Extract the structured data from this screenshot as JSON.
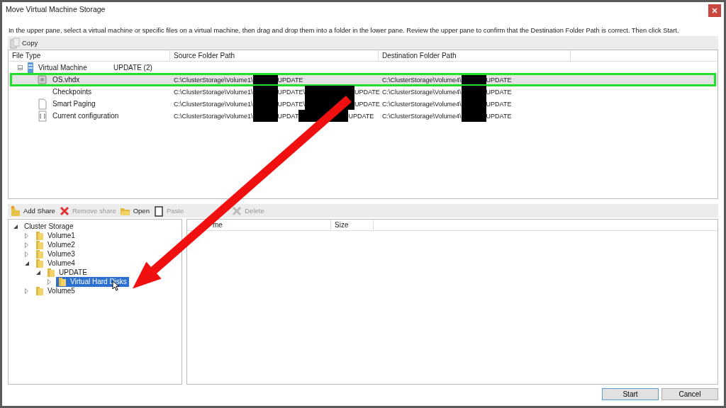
{
  "window": {
    "title": "Move Virtual Machine Storage"
  },
  "instructions": "In the upper pane, select a virtual machine or specific files on a virtual machine, then drag and drop them into a folder in the lower pane.  Review the upper pane to confirm that the Destination Folder Path is correct. Then click Start.",
  "upper_toolbar": [
    {
      "label": "Copy"
    }
  ],
  "upper_table": {
    "columns": [
      "File Type",
      "Source Folder Path",
      "Destination Folder Path"
    ],
    "group": {
      "label": "Virtual Machine",
      "name": "UPDATE (2)",
      "expanded": true
    },
    "rows": [
      {
        "kind": "disk",
        "name": "OS.vhdx",
        "selected": true,
        "source": [
          "C:\\ClusterStorage\\Volume1\\",
          "UPDATE"
        ],
        "destination": [
          "C:\\ClusterStorage\\Volume4\\",
          "UPDATE"
        ]
      },
      {
        "kind": "none",
        "name": "Checkpoints",
        "selected": false,
        "source": [
          "C:\\ClusterStorage\\Volume1\\",
          "UPDATE\\",
          "UPDATE"
        ],
        "destination": [
          "C:\\ClusterStorage\\Volume4\\",
          "UPDATE"
        ]
      },
      {
        "kind": "page",
        "name": "Smart Paging",
        "selected": false,
        "source": [
          "C:\\ClusterStorage\\Volume1\\",
          "UPDATE\\",
          "UPDATE"
        ],
        "destination": [
          "C:\\ClusterStorage\\Volume4\\",
          "UPDATE"
        ]
      },
      {
        "kind": "config",
        "name": "Current configuration",
        "selected": false,
        "source": [
          "C:\\ClusterStorage\\Volume1\\",
          "UPDAT",
          "UPDATE"
        ],
        "destination": [
          "C:\\ClusterStorage\\Volume4\\",
          "UPDATE"
        ]
      }
    ]
  },
  "lower_toolbar": [
    {
      "kind": "add",
      "label": "Add Share",
      "disabled": false
    },
    {
      "kind": "remove",
      "label": "Remove share",
      "disabled": true
    },
    {
      "kind": "open",
      "label": "Open",
      "disabled": false
    },
    {
      "kind": "paste",
      "label": "Paste",
      "disabled": true
    },
    {
      "kind": "delete",
      "label": "Delete",
      "disabled": true
    }
  ],
  "tree": [
    {
      "label": "Cluster Storage",
      "expanded": true,
      "selected": false,
      "children": [
        {
          "label": "Volume1",
          "expanded": false,
          "selected": false
        },
        {
          "label": "Volume2",
          "expanded": false,
          "selected": false
        },
        {
          "label": "Volume3",
          "expanded": false,
          "selected": false
        },
        {
          "label": "Volume4",
          "expanded": true,
          "selected": false,
          "children": [
            {
              "label": "UPDATE",
              "expanded": true,
              "selected": false,
              "children": [
                {
                  "label": "Virtual Hard Disks",
                  "expanded": false,
                  "selected": true
                }
              ]
            }
          ]
        },
        {
          "label": "Volume5",
          "expanded": false,
          "selected": false
        }
      ]
    }
  ],
  "file_list": {
    "columns": [
      "me",
      "Size"
    ]
  },
  "buttons": [
    {
      "label": "Start",
      "default": true
    },
    {
      "label": "Cancel",
      "default": false
    }
  ]
}
